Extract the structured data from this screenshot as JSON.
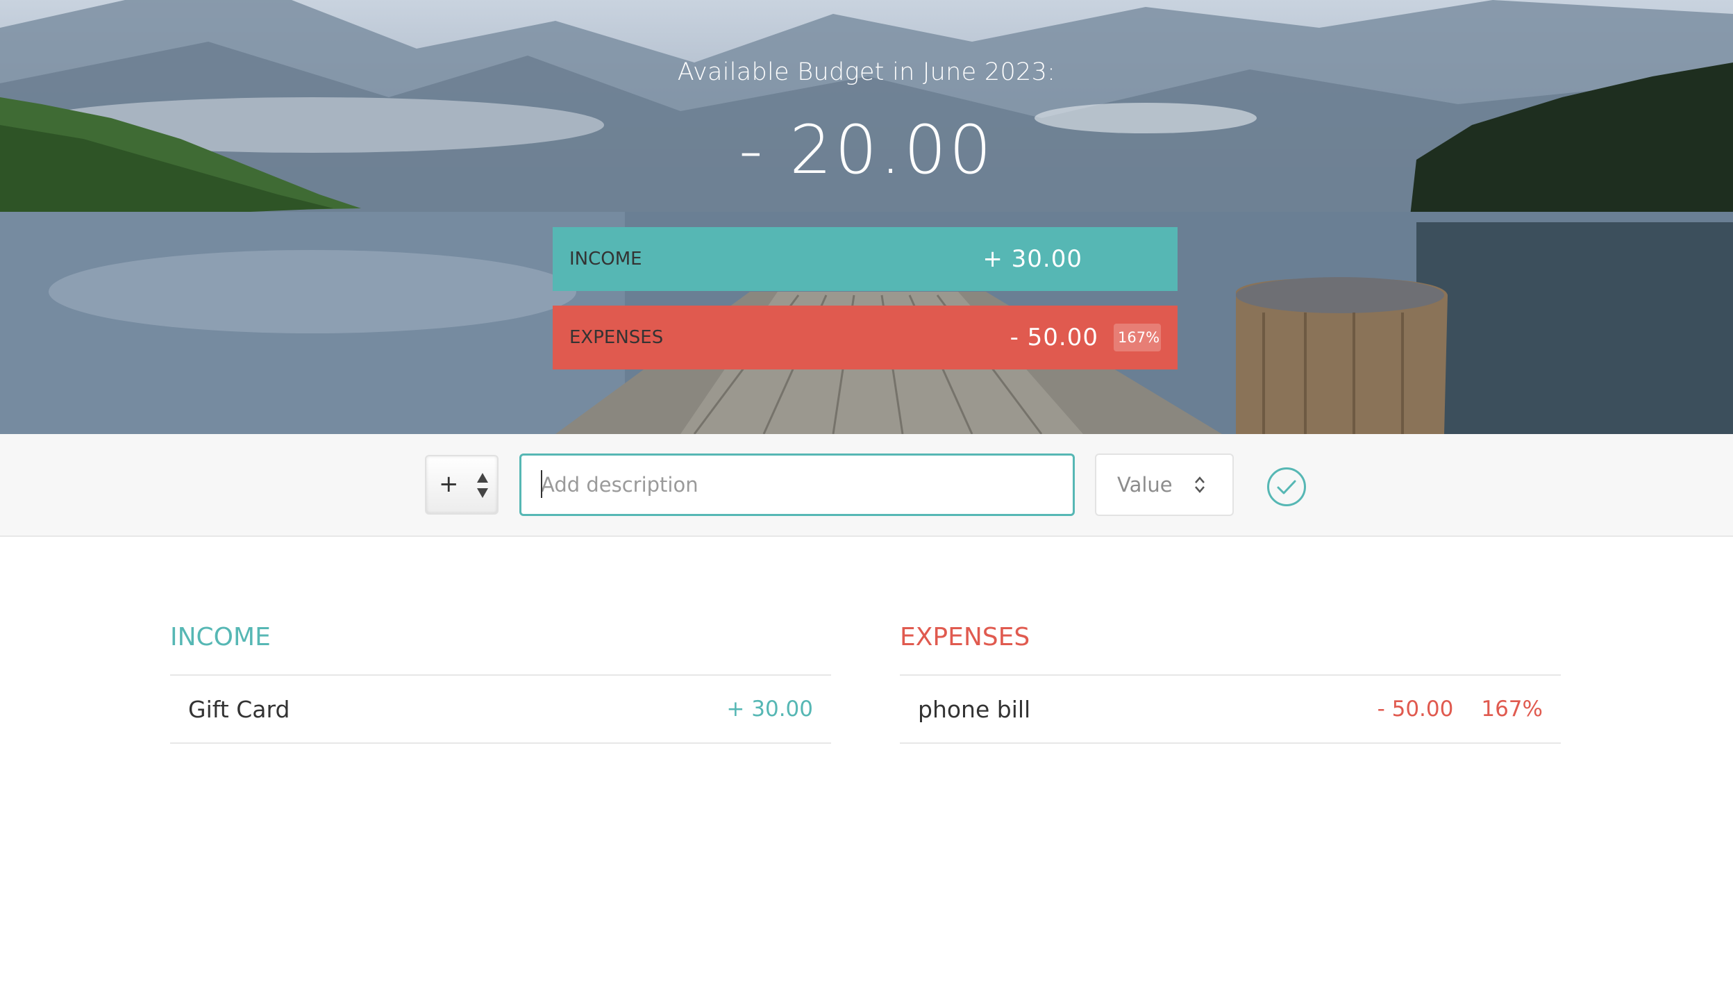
{
  "header": {
    "title": "Available Budget in June 2023:",
    "budget": "- 20.00",
    "income_label": "INCOME",
    "income_value": "+ 30.00",
    "expenses_label": "EXPENSES",
    "expenses_value": "- 50.00",
    "expenses_percentage": "167%"
  },
  "add_form": {
    "type_value": "+",
    "description_placeholder": "Add description",
    "value_placeholder": "Value",
    "submit_icon": "check-circle-icon"
  },
  "income_list": {
    "title": "INCOME",
    "items": [
      {
        "description": "Gift Card",
        "value": "+ 30.00"
      }
    ]
  },
  "expenses_list": {
    "title": "EXPENSES",
    "items": [
      {
        "description": "phone bill",
        "value": "- 50.00",
        "percentage": "167%"
      }
    ]
  },
  "colors": {
    "income": "#56b7b4",
    "expenses": "#e05a4f",
    "add_bar_background": "#f7f7f7"
  }
}
